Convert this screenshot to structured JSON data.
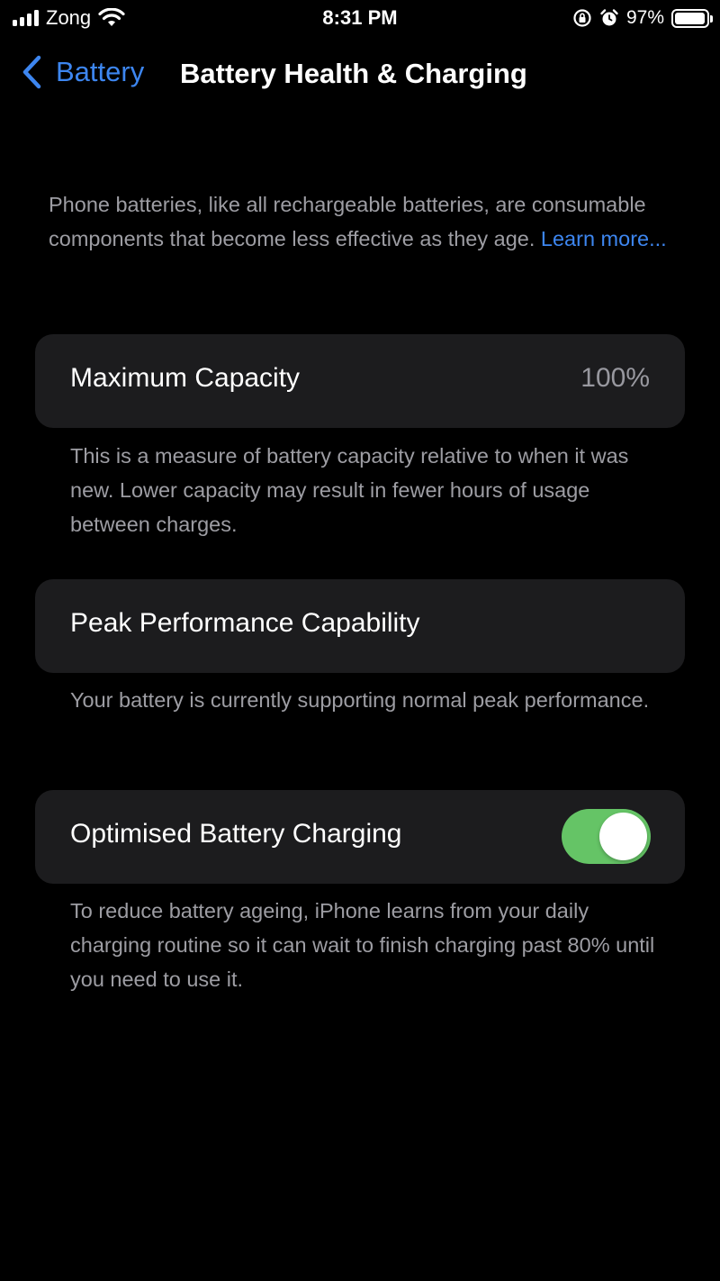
{
  "status_bar": {
    "carrier": "Zong",
    "time": "8:31 PM",
    "battery_percent": "97%",
    "battery_level": 0.97,
    "icons": [
      "signal-icon",
      "wifi-icon",
      "orientation-lock-icon",
      "alarm-icon",
      "battery-icon"
    ]
  },
  "nav": {
    "back_label": "Battery",
    "title": "Battery Health & Charging"
  },
  "intro": {
    "text": "Phone batteries, like all rechargeable batteries, are consumable components that become less effective as they age. ",
    "link": "Learn more..."
  },
  "maximum_capacity": {
    "label": "Maximum Capacity",
    "value": "100%",
    "footnote": "This is a measure of battery capacity relative to when it was new. Lower capacity may result in fewer hours of usage between charges."
  },
  "peak_performance": {
    "label": "Peak Performance Capability",
    "footnote": "Your battery is currently supporting normal peak performance."
  },
  "optimised_charging": {
    "label": "Optimised Battery Charging",
    "enabled": true,
    "toggle_color": "#65c466",
    "footnote": "To reduce battery ageing, iPhone learns from your daily charging routine so it can wait to finish charging past 80% until you need to use it."
  },
  "colors": {
    "accent": "#3d86f0",
    "card_background": "#1c1c1e",
    "secondary_text": "#9d9da3"
  }
}
